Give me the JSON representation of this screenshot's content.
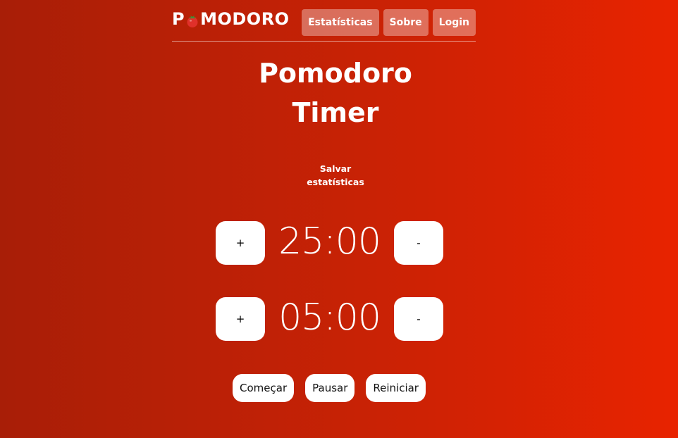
{
  "brand": {
    "prefix": "P",
    "suffix": "MODORO",
    "logo_icon": "tomato-icon",
    "colors": {
      "tomato": "#e0302a",
      "leaf": "#2e9b3a"
    }
  },
  "nav": {
    "items": [
      {
        "label": "Estatísticas"
      },
      {
        "label": "Sobre"
      },
      {
        "label": "Login"
      }
    ]
  },
  "title": {
    "line1": "Pomodoro",
    "line2": "Timer"
  },
  "save_stats": {
    "line1": "Salvar",
    "line2": "estatísticas"
  },
  "timers": {
    "work": {
      "time": "25:00",
      "increase_label": "+",
      "decrease_label": "-"
    },
    "break": {
      "time": "05:00",
      "increase_label": "+",
      "decrease_label": "-"
    }
  },
  "controls": {
    "start_label": "Começar",
    "pause_label": "Pausar",
    "reset_label": "Reiniciar"
  },
  "colors": {
    "background_left": "#a81e07",
    "background_right": "#e82300",
    "button_bg": "#ffffff"
  }
}
